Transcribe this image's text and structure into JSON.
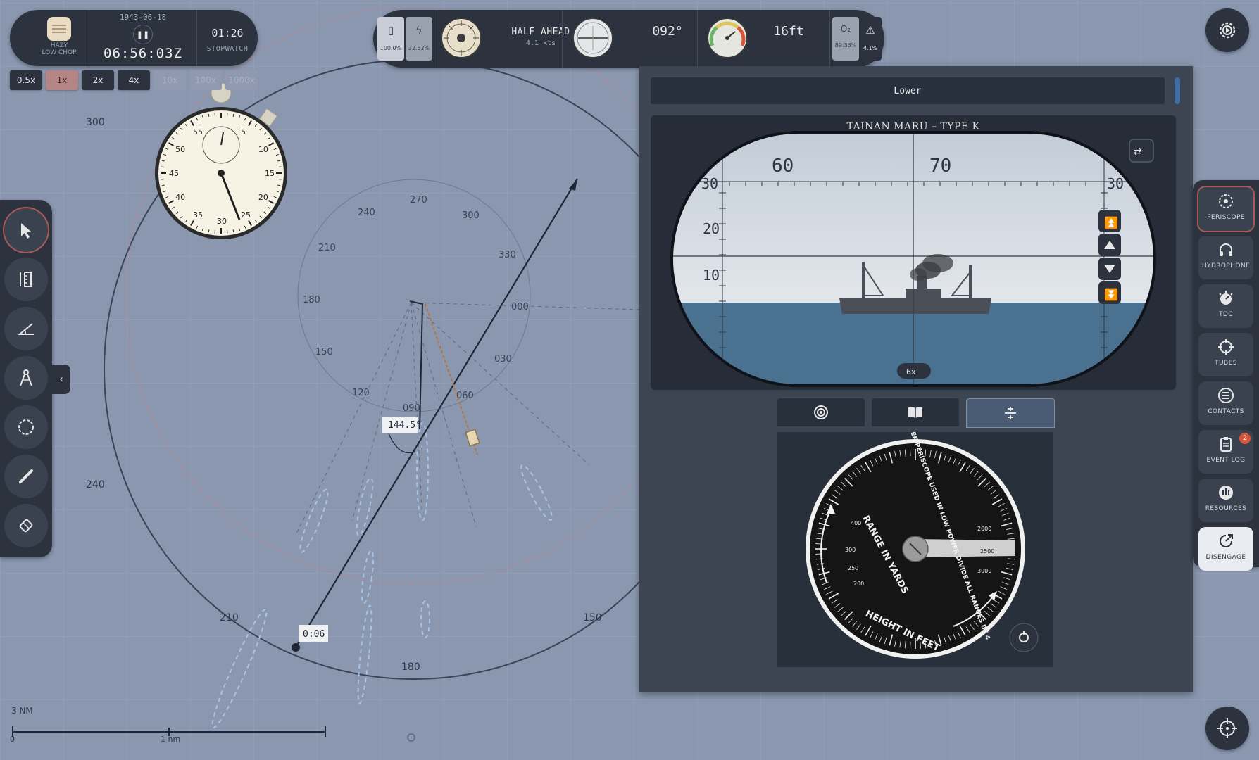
{
  "clock": {
    "weather_label": "HAZY\nLOW CHOP",
    "date": "1943-06-18",
    "time": "06:56:03Z",
    "stopwatch_time": "01:26",
    "stopwatch_label": "STOPWATCH"
  },
  "speed_buttons": [
    {
      "label": "0.5x",
      "state": "normal"
    },
    {
      "label": "1x",
      "state": "active"
    },
    {
      "label": "2x",
      "state": "normal"
    },
    {
      "label": "4x",
      "state": "normal"
    },
    {
      "label": "10x",
      "state": "disabled"
    },
    {
      "label": "100x",
      "state": "disabled"
    },
    {
      "label": "1000x",
      "state": "disabled"
    }
  ],
  "telegraph": {
    "battery_value": "100.0%",
    "power_value": "32.52%",
    "order": "HALF AHEAD",
    "speed": "4.1 kts",
    "heading": "092°",
    "depth": "16ft",
    "o2_label": "O₂",
    "o2_value": "89.36%",
    "warning_value": "4.1%"
  },
  "map": {
    "bearing_label": "144.5°",
    "time_marker": "0:06",
    "scale_range": "3 NM",
    "scale_start": "0",
    "scale_mid": "1 nm",
    "range_ring_labels": [
      "300",
      "240",
      "210",
      "180",
      "150"
    ],
    "bearing_circle_labels": [
      "270",
      "300",
      "330",
      "000",
      "030",
      "060",
      "090",
      "120",
      "150",
      "180",
      "210",
      "240"
    ]
  },
  "stopwatch_face": {
    "outer_numbers": [
      "5",
      "10",
      "15",
      "20",
      "25",
      "30",
      "35",
      "40",
      "45",
      "50",
      "55"
    ]
  },
  "periscope": {
    "mode": "Lower",
    "target": "TAINAN MARU – TYPE K",
    "scale_top": [
      "60",
      "70"
    ],
    "scale_side": [
      "30",
      "20",
      "10"
    ],
    "scale_right": "30",
    "magnification": "6x",
    "tabs": [
      "target-icon",
      "book-icon",
      "stadimeter-icon"
    ],
    "active_tab": 2
  },
  "range_dial": {
    "range_label": "RANGE IN YARDS",
    "height_label": "HEIGHT IN FEET",
    "instruction": "WHEN PERISCOPE USED IN LOW POWER DIVIDE ALL RANGES BY 4",
    "range_ticks": [
      "2000",
      "2500",
      "3000"
    ],
    "height_ticks": [
      "300",
      "250",
      "200",
      "400"
    ]
  },
  "stations": [
    {
      "label": "PERISCOPE",
      "icon": "periscope-icon"
    },
    {
      "label": "HYDROPHONE",
      "icon": "headphones-icon"
    },
    {
      "label": "TDC",
      "icon": "tdc-icon"
    },
    {
      "label": "TUBES",
      "icon": "crosshair-icon"
    },
    {
      "label": "CONTACTS",
      "icon": "list-icon"
    },
    {
      "label": "EVENT LOG",
      "icon": "clipboard-icon",
      "badge": "2"
    },
    {
      "label": "RESOURCES",
      "icon": "resources-icon"
    },
    {
      "label": "DISENGAGE",
      "icon": "disengage-icon"
    }
  ],
  "colors": {
    "map_bg": "#8a97af",
    "panel": "#2c333f",
    "active_outline": "#a85a58",
    "sea": "#4a7290",
    "sky": "#dfe4ea"
  }
}
